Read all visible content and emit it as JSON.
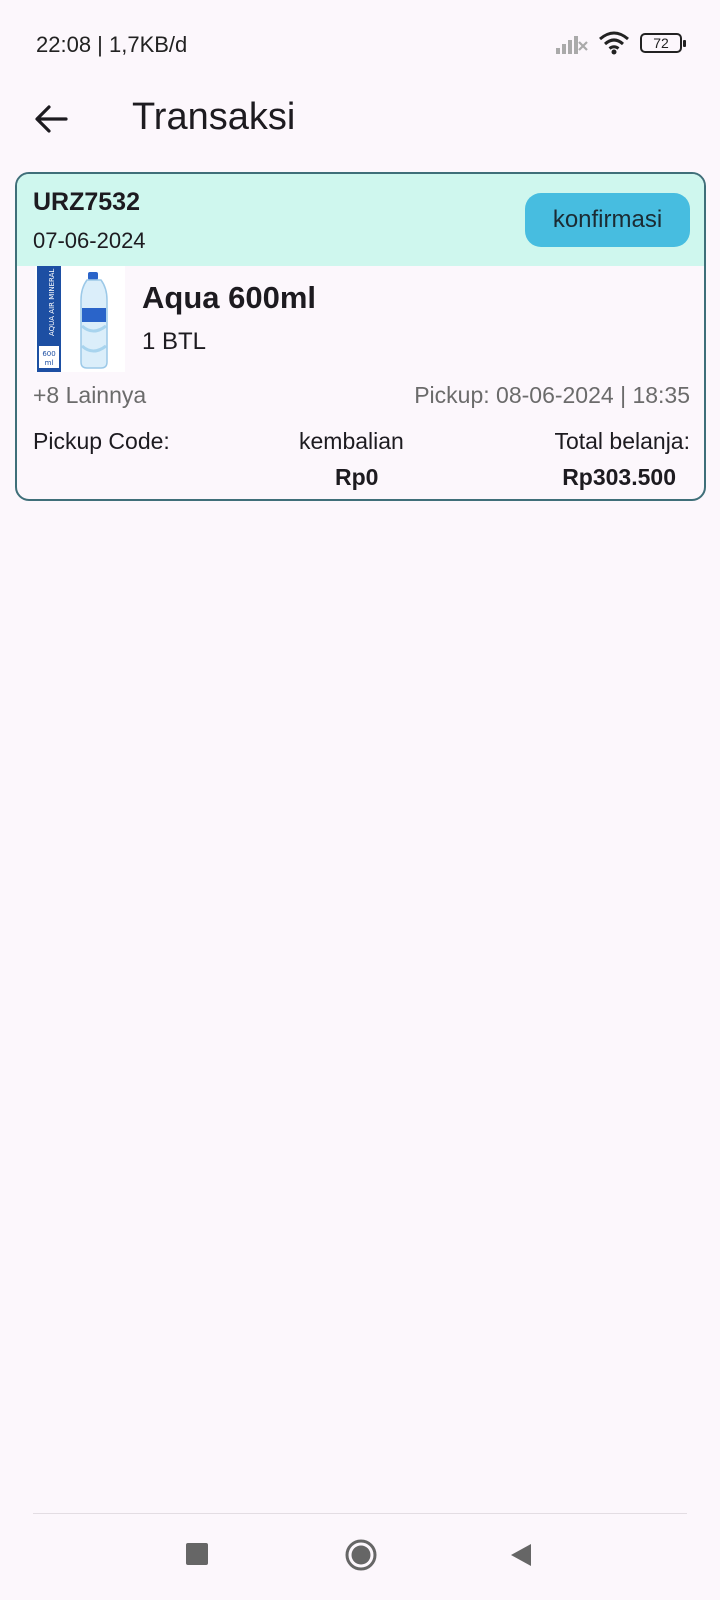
{
  "status_bar": {
    "time_speed": "22:08 | 1,7KB/d",
    "battery_level": "72",
    "icons": [
      "signal-off-icon",
      "wifi-icon",
      "battery-icon"
    ]
  },
  "app_bar": {
    "title": "Transaksi",
    "back_icon": "arrow-left-icon"
  },
  "transaction": {
    "order_id": "URZ7532",
    "date": "07-06-2024",
    "status_button": "konfirmasi",
    "product": {
      "name": "Aqua 600ml",
      "quantity": "1 BTL",
      "image_label_brand": "AQUA",
      "image_label_sub": "AIR MINERAL",
      "image_label_size": "600",
      "image_label_unit": "ml"
    },
    "more_items": "+8 Lainnya",
    "pickup": "Pickup: 08-06-2024 | 18:35",
    "pickup_code_label": "Pickup Code:",
    "change_label": "kembalian",
    "change_value": "Rp0",
    "total_label": "Total belanja:",
    "total_value": "Rp303.500"
  },
  "colors": {
    "background": "#fcf7fc",
    "card_header": "#cff7ee",
    "card_border": "#3f6f79",
    "confirm_button": "#47bde0"
  },
  "nav_bar": {
    "icons": [
      "recents-square-icon",
      "home-circle-icon",
      "back-triangle-icon"
    ]
  }
}
